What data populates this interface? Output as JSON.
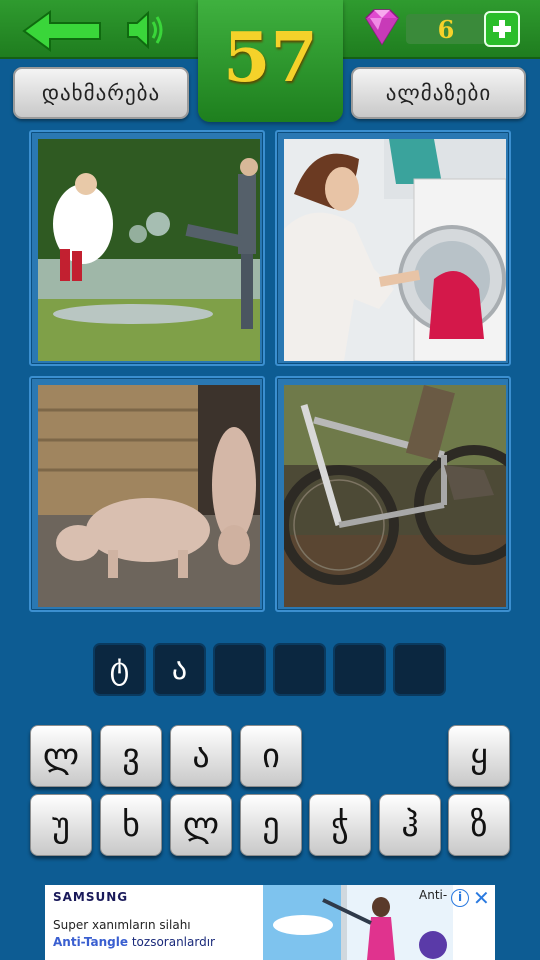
{
  "header": {
    "level": "57",
    "gem_count": "6",
    "help_label": "დახმარება",
    "diamonds_label": "ალმაზები",
    "colors": {
      "bar": "#2a8f2a",
      "level_text": "#f5d22a",
      "background": "#0d5c93"
    }
  },
  "icons": {
    "back": "back-arrow-icon",
    "sound": "speaker-icon",
    "gem": "gem-icon",
    "add": "plus-icon"
  },
  "puzzle_images": [
    {
      "name": "bride-jumping-in-puddle"
    },
    {
      "name": "woman-loading-washing-machine"
    },
    {
      "name": "pigs-in-mud"
    },
    {
      "name": "muddy-mountain-bike"
    }
  ],
  "answer_slots": [
    "ტ",
    "ა",
    "",
    "",
    "",
    ""
  ],
  "keyboard": {
    "row1": [
      "ლ",
      "ვ",
      "ა",
      "ი",
      "",
      "",
      "ყ"
    ],
    "row2": [
      "უ",
      "ხ",
      "ლ",
      "ე",
      "ჭ",
      "ჰ",
      "ზ"
    ]
  },
  "ad": {
    "brand": "SAMSUNG",
    "line1": "Super xanımların silahı",
    "line2_highlight": "Anti-Tangle",
    "line2_rest": " tozsoranlardır",
    "corner_text": "Anti-",
    "info": "i",
    "close": "✕"
  }
}
